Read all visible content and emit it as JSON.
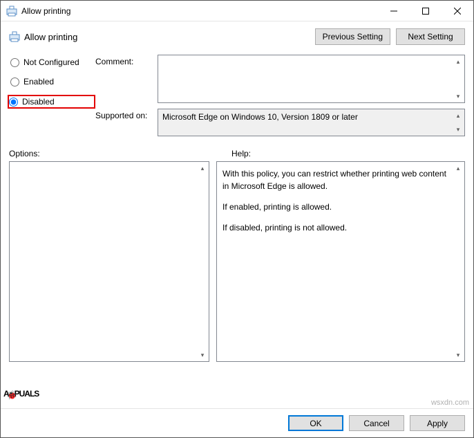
{
  "window": {
    "title": "Allow printing"
  },
  "header": {
    "title": "Allow printing",
    "prev_button": "Previous Setting",
    "next_button": "Next Setting"
  },
  "radios": {
    "not_configured": "Not Configured",
    "enabled": "Enabled",
    "disabled": "Disabled",
    "selected": "disabled"
  },
  "fields": {
    "comment_label": "Comment:",
    "comment_value": "",
    "supported_label": "Supported on:",
    "supported_value": "Microsoft Edge on Windows 10, Version 1809 or later"
  },
  "panels": {
    "options_label": "Options:",
    "help_label": "Help:",
    "help_p1": "With this policy, you can restrict whether printing web content in Microsoft Edge is allowed.",
    "help_p2": "If enabled, printing is allowed.",
    "help_p3": "If disabled, printing is not allowed."
  },
  "buttons": {
    "ok": "OK",
    "cancel": "Cancel",
    "apply": "Apply"
  },
  "watermark": {
    "left_pre": "A",
    "left_post": "PUALS",
    "right": "wsxdn.com"
  }
}
